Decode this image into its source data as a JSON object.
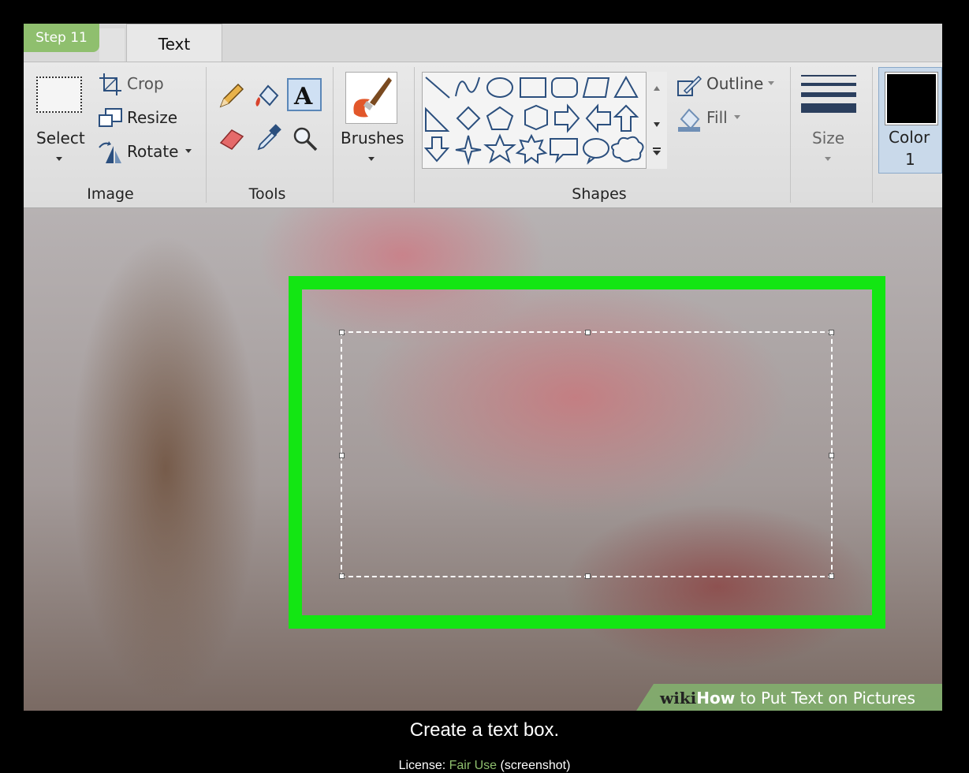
{
  "step_badge": "Step 11",
  "tabs": {
    "active": "Text"
  },
  "ribbon": {
    "image_group": {
      "label": "Image",
      "select": "Select",
      "crop": "Crop",
      "resize": "Resize",
      "rotate": "Rotate"
    },
    "tools_group": {
      "label": "Tools"
    },
    "brushes": "Brushes",
    "shapes_group": {
      "label": "Shapes",
      "outline": "Outline",
      "fill": "Fill"
    },
    "size": "Size",
    "color1": {
      "label": "Color",
      "number": "1",
      "value": "#000000"
    }
  },
  "canvas": {
    "highlight_color": "#13e613"
  },
  "watermark": {
    "brand_prefix": "wiki",
    "brand_suffix": "How",
    "title": "to Put Text on Pictures"
  },
  "caption": "Create a text box.",
  "license": {
    "prefix": "License: ",
    "link": "Fair Use",
    "suffix": " (screenshot)"
  }
}
